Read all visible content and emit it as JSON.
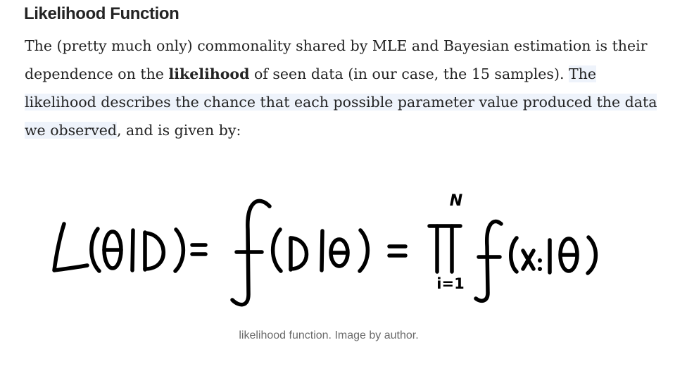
{
  "article": {
    "heading": "Likelihood Function",
    "paragraph": {
      "part1": "The (pretty much only) commonality shared by MLE and Bayesian estimation is their dependence on the ",
      "bold": "likelihood",
      "part2": " of seen data (in our case, the 15 samples). ",
      "highlight": "The likelihood describes the chance that each possible parameter value produced the data we observed",
      "part3": ", and is given by:"
    },
    "figure": {
      "formula_superscript": "N",
      "formula_subscript": "i=1",
      "caption": "likelihood function. Image by author."
    }
  }
}
